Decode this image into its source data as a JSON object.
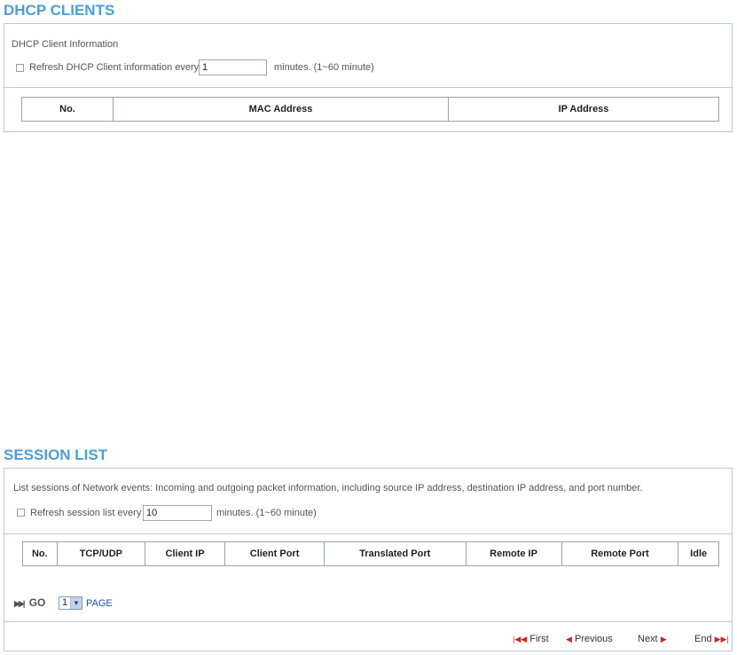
{
  "dhcp": {
    "title": "DHCP CLIENTS",
    "info_label": "DHCP Client Information",
    "refresh_label": "Refresh DHCP Client information every",
    "refresh_value": "1",
    "minutes_hint": "minutes. (1~60 minute)",
    "columns": [
      "No.",
      "MAC Address",
      "IP Address"
    ]
  },
  "session": {
    "title": "SESSION LIST",
    "description": "List sessions of Network events: Incoming and outgoing packet information, including source IP address, destination IP address, and port number.",
    "refresh_label": "Refresh session list every",
    "refresh_value": "10",
    "minutes_hint": "minutes. (1~60 minute)",
    "columns": [
      "No.",
      "TCP/UDP",
      "Client IP",
      "Client Port",
      "Translated Port",
      "Remote IP",
      "Remote Port",
      "Idle"
    ],
    "go_label": "GO",
    "page_value": "1",
    "page_label": "PAGE",
    "nav": {
      "first": "First",
      "previous": "Previous",
      "next": "Next",
      "end": "End"
    }
  },
  "colors": {
    "accent": "#4a9fd8",
    "border": "#b9cbd9",
    "nav_icon": "#d41f1f"
  }
}
